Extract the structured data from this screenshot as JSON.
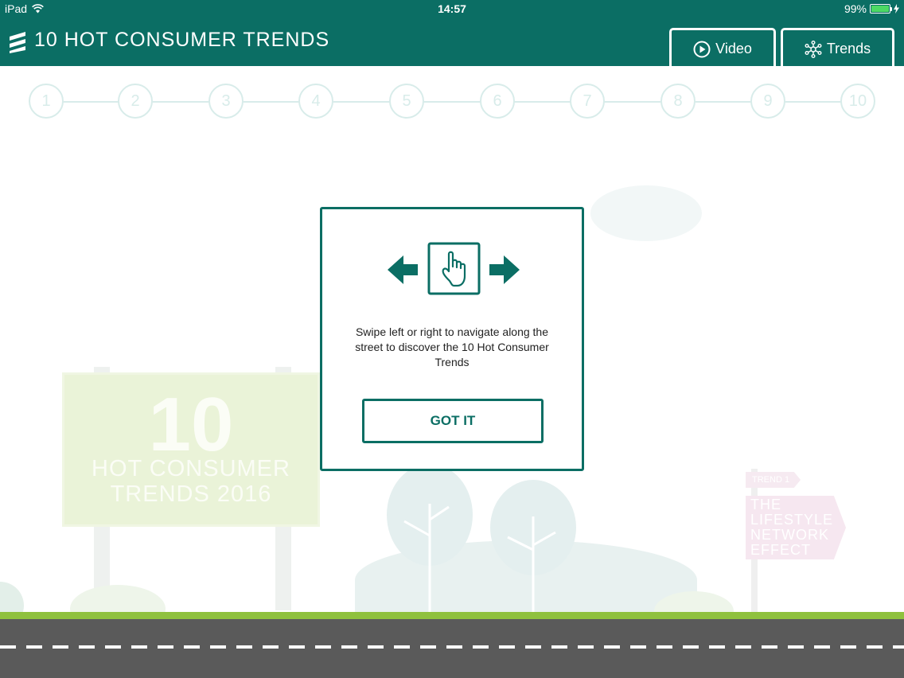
{
  "status_bar": {
    "device": "iPad",
    "time": "14:57",
    "battery": "99%",
    "battery_level": 0.99,
    "wifi_icon": "wifi-icon",
    "charging_icon": "lightning-icon"
  },
  "header": {
    "title": "10 HOT CONSUMER TRENDS",
    "logo_icon": "ericsson-logo-icon",
    "video_label": "Video",
    "trends_label": "Trends"
  },
  "steps": [
    "1",
    "2",
    "3",
    "4",
    "5",
    "6",
    "7",
    "8",
    "9",
    "10"
  ],
  "scene": {
    "billboard_number": "10",
    "billboard_line1": "HOT CONSUMER",
    "billboard_line2": "TRENDS 2016",
    "sign_tag": "TREND 1",
    "sign_text": [
      "THE",
      "LIFESTYLE",
      "NETWORK",
      "EFFECT"
    ]
  },
  "modal": {
    "instruction": "Swipe left or right to navigate along the street to discover the 10 Hot Consumer Trends",
    "button_label": "GOT IT"
  },
  "colors": {
    "brand": "#0b6e64",
    "step_circle": "#d8ecea",
    "grass": "#8fc13e",
    "road": "#5a5a5a"
  }
}
